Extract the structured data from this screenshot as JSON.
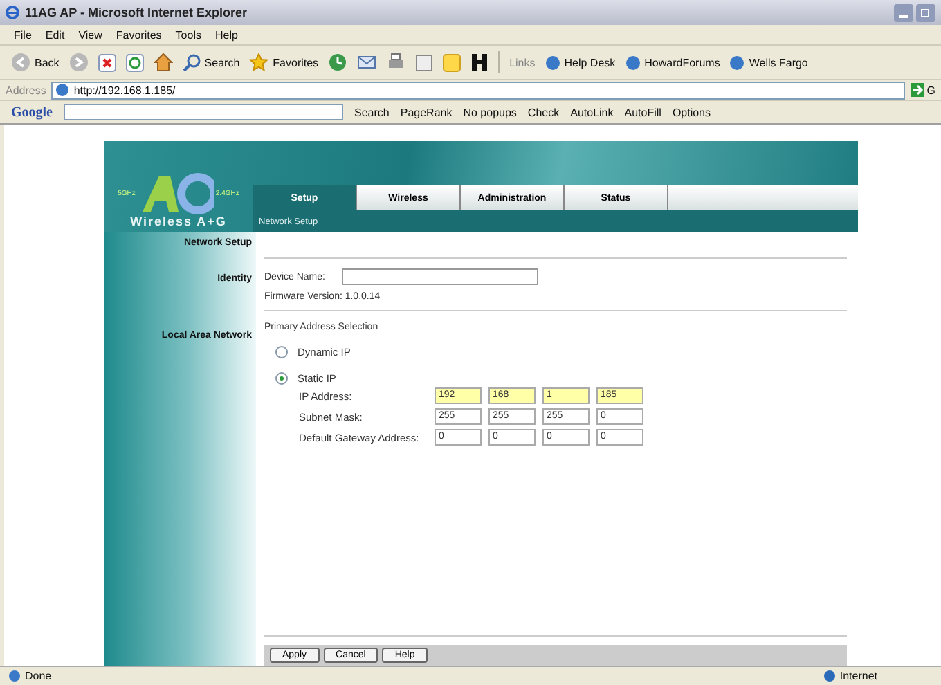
{
  "window": {
    "title": "11AG AP - Microsoft Internet Explorer"
  },
  "menu": [
    "File",
    "Edit",
    "View",
    "Favorites",
    "Tools",
    "Help"
  ],
  "toolbar": {
    "back": "Back",
    "search": "Search",
    "favorites": "Favorites",
    "links_label": "Links",
    "links": [
      "Help Desk",
      "HowardForums",
      "Wells Fargo"
    ]
  },
  "address": {
    "label": "Address",
    "url": "http://192.168.1.185/",
    "go": "G"
  },
  "google_bar": {
    "brand": "Google",
    "search": "Search",
    "pagerank": "PageRank",
    "popups": "No popups",
    "check": "Check",
    "autolink": "AutoLink",
    "autofill": "AutoFill",
    "options": "Options"
  },
  "page": {
    "logo": "Wireless A+G",
    "logo_left": "5GHz",
    "logo_right": "2.4GHz",
    "tabs": [
      {
        "label": "Setup",
        "selected": true
      },
      {
        "label": "Wireless",
        "selected": false
      },
      {
        "label": "Administration",
        "selected": false
      },
      {
        "label": "Status",
        "selected": false
      }
    ],
    "subnav": "Network Setup",
    "section_title": "Network Setup",
    "identity": {
      "label": "Identity",
      "device_name_label": "Device Name:",
      "firmware": "Firmware Version: 1.0.0.14"
    },
    "lan": {
      "label": "Local Area Network",
      "heading": "Primary Address Selection",
      "radios": [
        {
          "label": "Dynamic IP",
          "selected": false
        },
        {
          "label": "Static IP",
          "selected": true
        }
      ],
      "rows": [
        {
          "label": "IP Address:",
          "highlighted": true,
          "octets": [
            "192",
            "168",
            "1",
            "185"
          ]
        },
        {
          "label": "Subnet Mask:",
          "highlighted": false,
          "octets": [
            "255",
            "255",
            "255",
            "0"
          ]
        },
        {
          "label": "Default Gateway Address:",
          "highlighted": false,
          "octets": [
            "0",
            "0",
            "0",
            "0"
          ]
        }
      ]
    },
    "buttons": [
      "Apply",
      "Cancel",
      "Help"
    ]
  },
  "status_bar": {
    "text": "Done",
    "zone": "Internet"
  }
}
